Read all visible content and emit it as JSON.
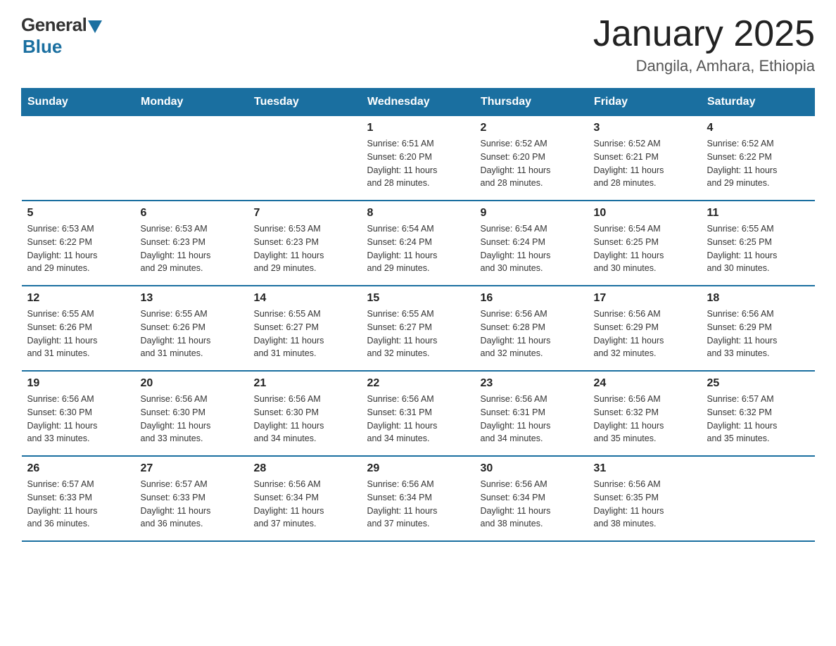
{
  "header": {
    "logo_general": "General",
    "logo_blue": "Blue",
    "logo_tagline": "",
    "title": "January 2025",
    "subtitle": "Dangila, Amhara, Ethiopia"
  },
  "days_of_week": [
    "Sunday",
    "Monday",
    "Tuesday",
    "Wednesday",
    "Thursday",
    "Friday",
    "Saturday"
  ],
  "weeks": [
    [
      {
        "day": "",
        "info": ""
      },
      {
        "day": "",
        "info": ""
      },
      {
        "day": "",
        "info": ""
      },
      {
        "day": "1",
        "info": "Sunrise: 6:51 AM\nSunset: 6:20 PM\nDaylight: 11 hours\nand 28 minutes."
      },
      {
        "day": "2",
        "info": "Sunrise: 6:52 AM\nSunset: 6:20 PM\nDaylight: 11 hours\nand 28 minutes."
      },
      {
        "day": "3",
        "info": "Sunrise: 6:52 AM\nSunset: 6:21 PM\nDaylight: 11 hours\nand 28 minutes."
      },
      {
        "day": "4",
        "info": "Sunrise: 6:52 AM\nSunset: 6:22 PM\nDaylight: 11 hours\nand 29 minutes."
      }
    ],
    [
      {
        "day": "5",
        "info": "Sunrise: 6:53 AM\nSunset: 6:22 PM\nDaylight: 11 hours\nand 29 minutes."
      },
      {
        "day": "6",
        "info": "Sunrise: 6:53 AM\nSunset: 6:23 PM\nDaylight: 11 hours\nand 29 minutes."
      },
      {
        "day": "7",
        "info": "Sunrise: 6:53 AM\nSunset: 6:23 PM\nDaylight: 11 hours\nand 29 minutes."
      },
      {
        "day": "8",
        "info": "Sunrise: 6:54 AM\nSunset: 6:24 PM\nDaylight: 11 hours\nand 29 minutes."
      },
      {
        "day": "9",
        "info": "Sunrise: 6:54 AM\nSunset: 6:24 PM\nDaylight: 11 hours\nand 30 minutes."
      },
      {
        "day": "10",
        "info": "Sunrise: 6:54 AM\nSunset: 6:25 PM\nDaylight: 11 hours\nand 30 minutes."
      },
      {
        "day": "11",
        "info": "Sunrise: 6:55 AM\nSunset: 6:25 PM\nDaylight: 11 hours\nand 30 minutes."
      }
    ],
    [
      {
        "day": "12",
        "info": "Sunrise: 6:55 AM\nSunset: 6:26 PM\nDaylight: 11 hours\nand 31 minutes."
      },
      {
        "day": "13",
        "info": "Sunrise: 6:55 AM\nSunset: 6:26 PM\nDaylight: 11 hours\nand 31 minutes."
      },
      {
        "day": "14",
        "info": "Sunrise: 6:55 AM\nSunset: 6:27 PM\nDaylight: 11 hours\nand 31 minutes."
      },
      {
        "day": "15",
        "info": "Sunrise: 6:55 AM\nSunset: 6:27 PM\nDaylight: 11 hours\nand 32 minutes."
      },
      {
        "day": "16",
        "info": "Sunrise: 6:56 AM\nSunset: 6:28 PM\nDaylight: 11 hours\nand 32 minutes."
      },
      {
        "day": "17",
        "info": "Sunrise: 6:56 AM\nSunset: 6:29 PM\nDaylight: 11 hours\nand 32 minutes."
      },
      {
        "day": "18",
        "info": "Sunrise: 6:56 AM\nSunset: 6:29 PM\nDaylight: 11 hours\nand 33 minutes."
      }
    ],
    [
      {
        "day": "19",
        "info": "Sunrise: 6:56 AM\nSunset: 6:30 PM\nDaylight: 11 hours\nand 33 minutes."
      },
      {
        "day": "20",
        "info": "Sunrise: 6:56 AM\nSunset: 6:30 PM\nDaylight: 11 hours\nand 33 minutes."
      },
      {
        "day": "21",
        "info": "Sunrise: 6:56 AM\nSunset: 6:30 PM\nDaylight: 11 hours\nand 34 minutes."
      },
      {
        "day": "22",
        "info": "Sunrise: 6:56 AM\nSunset: 6:31 PM\nDaylight: 11 hours\nand 34 minutes."
      },
      {
        "day": "23",
        "info": "Sunrise: 6:56 AM\nSunset: 6:31 PM\nDaylight: 11 hours\nand 34 minutes."
      },
      {
        "day": "24",
        "info": "Sunrise: 6:56 AM\nSunset: 6:32 PM\nDaylight: 11 hours\nand 35 minutes."
      },
      {
        "day": "25",
        "info": "Sunrise: 6:57 AM\nSunset: 6:32 PM\nDaylight: 11 hours\nand 35 minutes."
      }
    ],
    [
      {
        "day": "26",
        "info": "Sunrise: 6:57 AM\nSunset: 6:33 PM\nDaylight: 11 hours\nand 36 minutes."
      },
      {
        "day": "27",
        "info": "Sunrise: 6:57 AM\nSunset: 6:33 PM\nDaylight: 11 hours\nand 36 minutes."
      },
      {
        "day": "28",
        "info": "Sunrise: 6:56 AM\nSunset: 6:34 PM\nDaylight: 11 hours\nand 37 minutes."
      },
      {
        "day": "29",
        "info": "Sunrise: 6:56 AM\nSunset: 6:34 PM\nDaylight: 11 hours\nand 37 minutes."
      },
      {
        "day": "30",
        "info": "Sunrise: 6:56 AM\nSunset: 6:34 PM\nDaylight: 11 hours\nand 38 minutes."
      },
      {
        "day": "31",
        "info": "Sunrise: 6:56 AM\nSunset: 6:35 PM\nDaylight: 11 hours\nand 38 minutes."
      },
      {
        "day": "",
        "info": ""
      }
    ]
  ]
}
